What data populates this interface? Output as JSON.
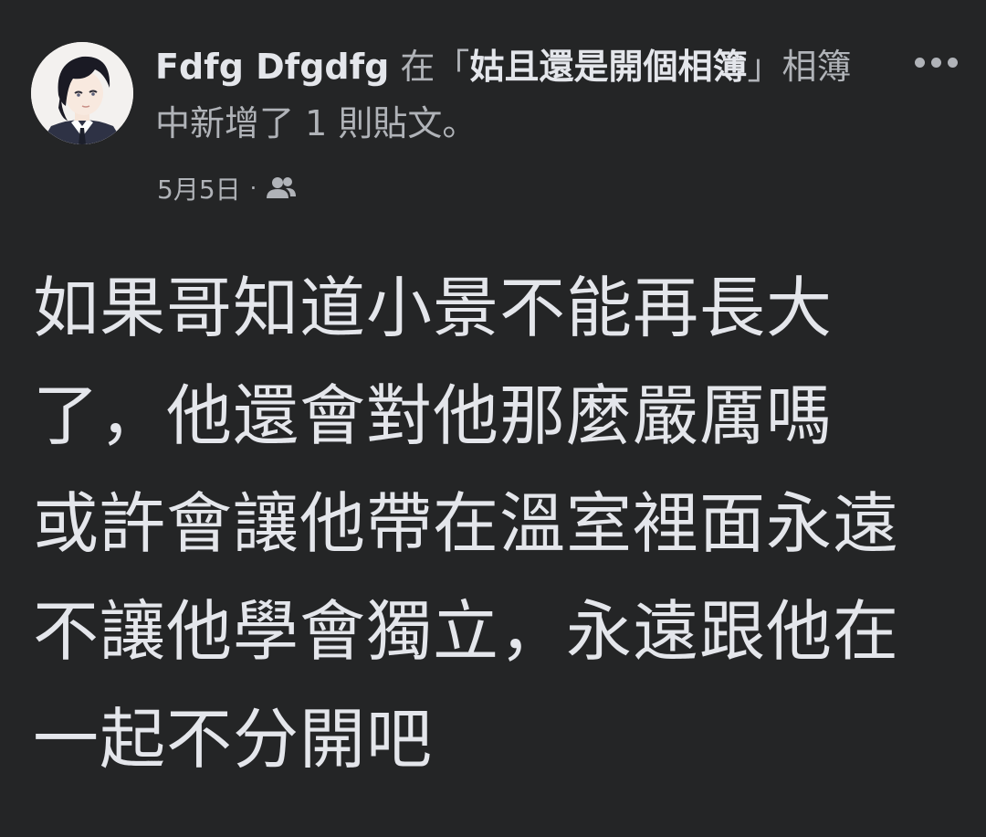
{
  "post": {
    "author": "Fdfg Dfgdfg",
    "action_prefix": " 在「",
    "album_name": "姑且還是開個相簿",
    "action_suffix": "」相簿中新增了 1 則貼文。",
    "date": "5月5日",
    "separator": "·",
    "audience_icon": "friends-icon",
    "more_icon": "more-options-icon",
    "lines": [
      "如果哥知道小景不能再長大",
      "了，他還會對他那麼嚴厲嗎",
      "或許會讓他帶在溫室裡面永遠",
      "不讓他學會獨立，永遠跟他在",
      "一起不分開吧"
    ]
  },
  "colors": {
    "background": "#242526",
    "primary_text": "#e4e6eb",
    "secondary_text": "#b0b3b8"
  }
}
